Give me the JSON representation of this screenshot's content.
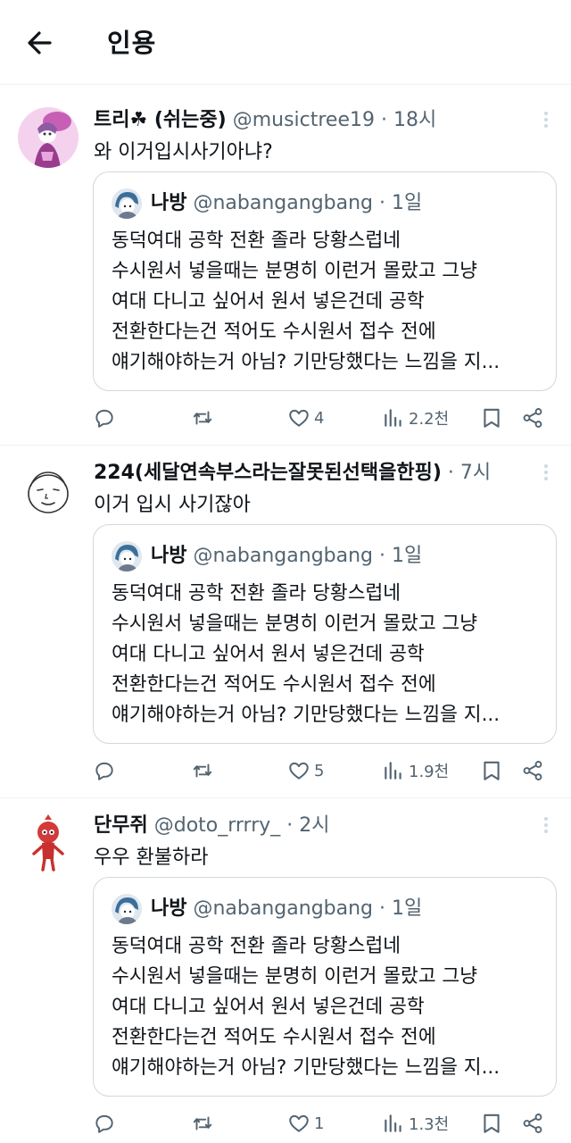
{
  "header": {
    "title": "인용",
    "back_icon": "arrow-left-icon"
  },
  "quoted": {
    "name": "나방",
    "handle": "@nabangangbang",
    "time": "1일",
    "lines": [
      "동덕여대 공학 전환 졸라 당황스럽네",
      "수시원서 넣을때는 분명히 이런거 몰랐고 그냥",
      "여대 다니고 싶어서 원서 넣은건데 공학",
      "전환한다는건 적어도 수시원서 접수 전에",
      "얘기해야하는거 아님? 기만당했다는 느낌을 지..."
    ]
  },
  "tweets": [
    {
      "name": "트리☘ (쉬는중)",
      "handle": "@musictree19",
      "time": "18시",
      "text": "와 이거입시사기아냐?",
      "likes": "4",
      "views": "2.2천"
    },
    {
      "name": "224(세달연속부스라는잘못된선택을한핑)",
      "handle": "",
      "time": "7시",
      "text": "이거 입시 사기잖아",
      "likes": "5",
      "views": "1.9천"
    },
    {
      "name": "단무쥐",
      "handle": "@doto_rrrry_",
      "time": "2시",
      "text": "우우 환불하라",
      "likes": "1",
      "views": "1.3천"
    }
  ],
  "separator": "·",
  "colors": {
    "text": "#0f1419",
    "secondary": "#536471",
    "border": "#cfd9de"
  }
}
